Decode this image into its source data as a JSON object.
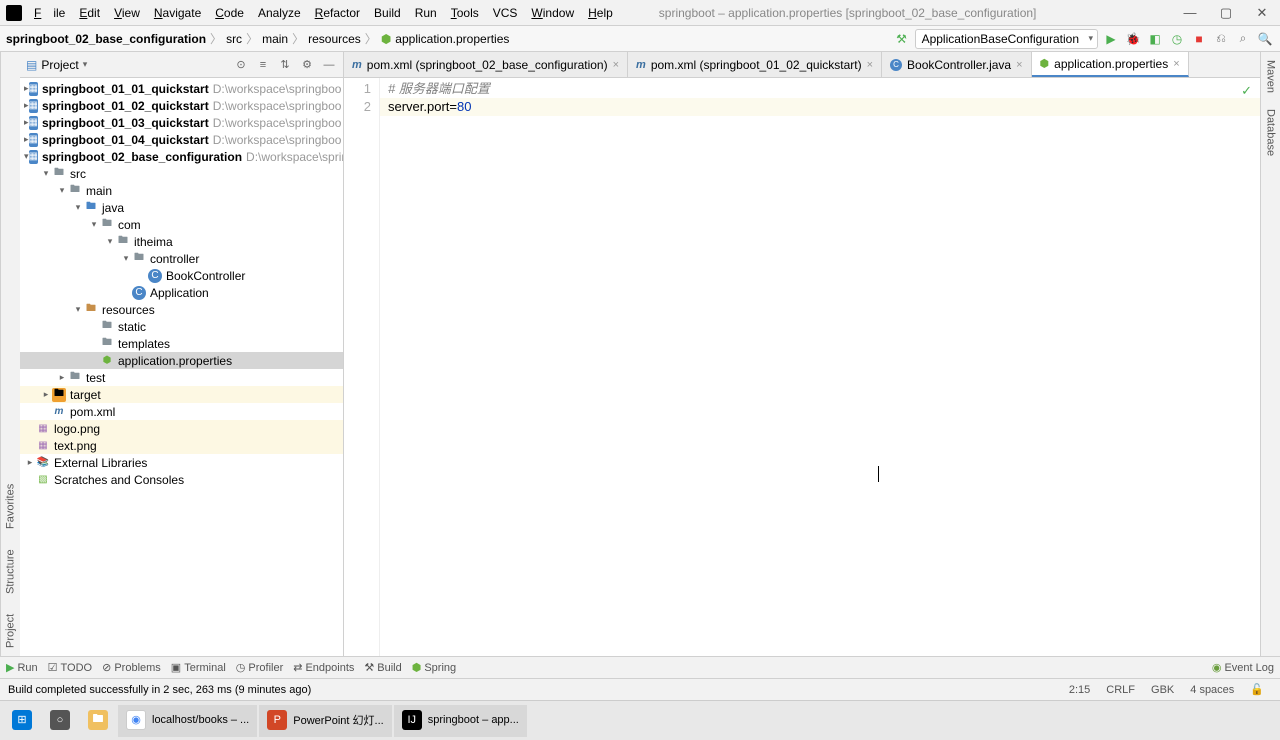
{
  "menu": {
    "file": "File",
    "edit": "Edit",
    "view": "View",
    "navigate": "Navigate",
    "code": "Code",
    "analyze": "Analyze",
    "refactor": "Refactor",
    "build": "Build",
    "run": "Run",
    "tools": "Tools",
    "vcs": "VCS",
    "window": "Window",
    "help": "Help"
  },
  "window_title": "springboot – application.properties [springboot_02_base_configuration]",
  "breadcrumb": {
    "proj": "springboot_02_base_configuration",
    "p1": "src",
    "p2": "main",
    "p3": "resources",
    "file": "application.properties"
  },
  "run_config": "ApplicationBaseConfiguration",
  "project_label": "Project",
  "tree": {
    "m1": "springboot_01_01_quickstart",
    "m1p": "D:\\workspace\\springboo",
    "m2": "springboot_01_02_quickstart",
    "m2p": "D:\\workspace\\springboo",
    "m3": "springboot_01_03_quickstart",
    "m3p": "D:\\workspace\\springboo",
    "m4": "springboot_01_04_quickstart",
    "m4p": "D:\\workspace\\springboo",
    "m5": "springboot_02_base_configuration",
    "m5p": "D:\\workspace\\sprin",
    "src": "src",
    "main": "main",
    "java": "java",
    "com": "com",
    "itheima": "itheima",
    "controller": "controller",
    "bookctrl": "BookController",
    "app": "Application",
    "resources": "resources",
    "static": "static",
    "templates": "templates",
    "appprops": "application.properties",
    "test": "test",
    "target": "target",
    "pom": "pom.xml",
    "logo": "logo.png",
    "text": "text.png",
    "extlib": "External Libraries",
    "scratch": "Scratches and Consoles"
  },
  "tabs": {
    "t1": "pom.xml (springboot_02_base_configuration)",
    "t2": "pom.xml (springboot_01_02_quickstart)",
    "t3": "BookController.java",
    "t4": "application.properties"
  },
  "code": {
    "l1": "# 服务器端口配置",
    "l2_key": "server.port",
    "l2_eq": "=",
    "l2_val": "80",
    "ln1": "1",
    "ln2": "2"
  },
  "right": {
    "maven": "Maven",
    "db": "Database"
  },
  "left": {
    "project": "Project",
    "structure": "Structure",
    "favorites": "Favorites"
  },
  "tooltabs": {
    "run": "Run",
    "todo": "TODO",
    "problems": "Problems",
    "terminal": "Terminal",
    "profiler": "Profiler",
    "endpoints": "Endpoints",
    "build": "Build",
    "spring": "Spring",
    "eventlog": "Event Log"
  },
  "status": {
    "msg": "Build completed successfully in 2 sec, 263 ms (9 minutes ago)",
    "pos": "2:15",
    "le": "CRLF",
    "enc": "GBK",
    "indent": "4 spaces"
  },
  "taskbar": {
    "chrome": "localhost/books – ...",
    "ppt": "PowerPoint 幻灯...",
    "ij": "springboot – app..."
  }
}
